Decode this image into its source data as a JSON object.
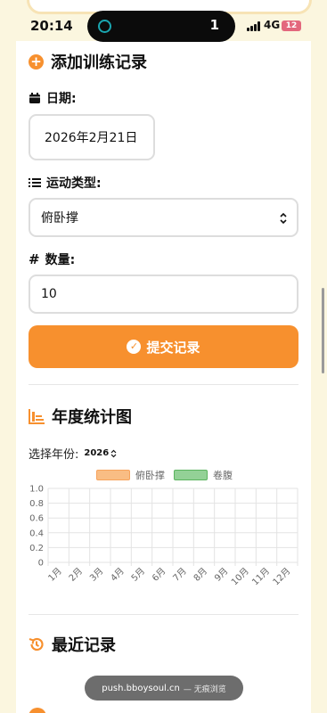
{
  "status_bar": {
    "time": "20:14",
    "island_count": "1",
    "network": "4G",
    "battery": "12"
  },
  "form": {
    "title": "添加训练记录",
    "date_label": "日期:",
    "date_value": "2026年2月21日",
    "type_label": "运动类型:",
    "type_value": "俯卧撑",
    "qty_label": "数量:",
    "qty_value": "10",
    "submit_label": "提交记录"
  },
  "stats": {
    "title": "年度统计图",
    "year_label": "选择年份:",
    "year_value": "2026"
  },
  "chart_data": {
    "type": "bar",
    "categories": [
      "1月",
      "2月",
      "3月",
      "4月",
      "5月",
      "6月",
      "7月",
      "8月",
      "9月",
      "10月",
      "11月",
      "12月"
    ],
    "series": [
      {
        "name": "俯卧撑",
        "values": [
          0,
          0,
          0,
          0,
          0,
          0,
          0,
          0,
          0,
          0,
          0,
          0
        ],
        "color": "#f7a35c"
      },
      {
        "name": "卷腹",
        "values": [
          0,
          0,
          0,
          0,
          0,
          0,
          0,
          0,
          0,
          0,
          0,
          0
        ],
        "color": "#7cc47f"
      }
    ],
    "yticks": [
      "1.0",
      "0.8",
      "0.6",
      "0.4",
      "0.2",
      "0"
    ],
    "ylim": [
      0,
      1
    ],
    "grid": true,
    "legend": "top"
  },
  "recent": {
    "title": "最近记录"
  },
  "toast": {
    "domain": "push.bboysoul.cn",
    "mode": "— 无痕浏览"
  },
  "colors": {
    "accent": "#f7902e",
    "background": "#fbf6df"
  }
}
